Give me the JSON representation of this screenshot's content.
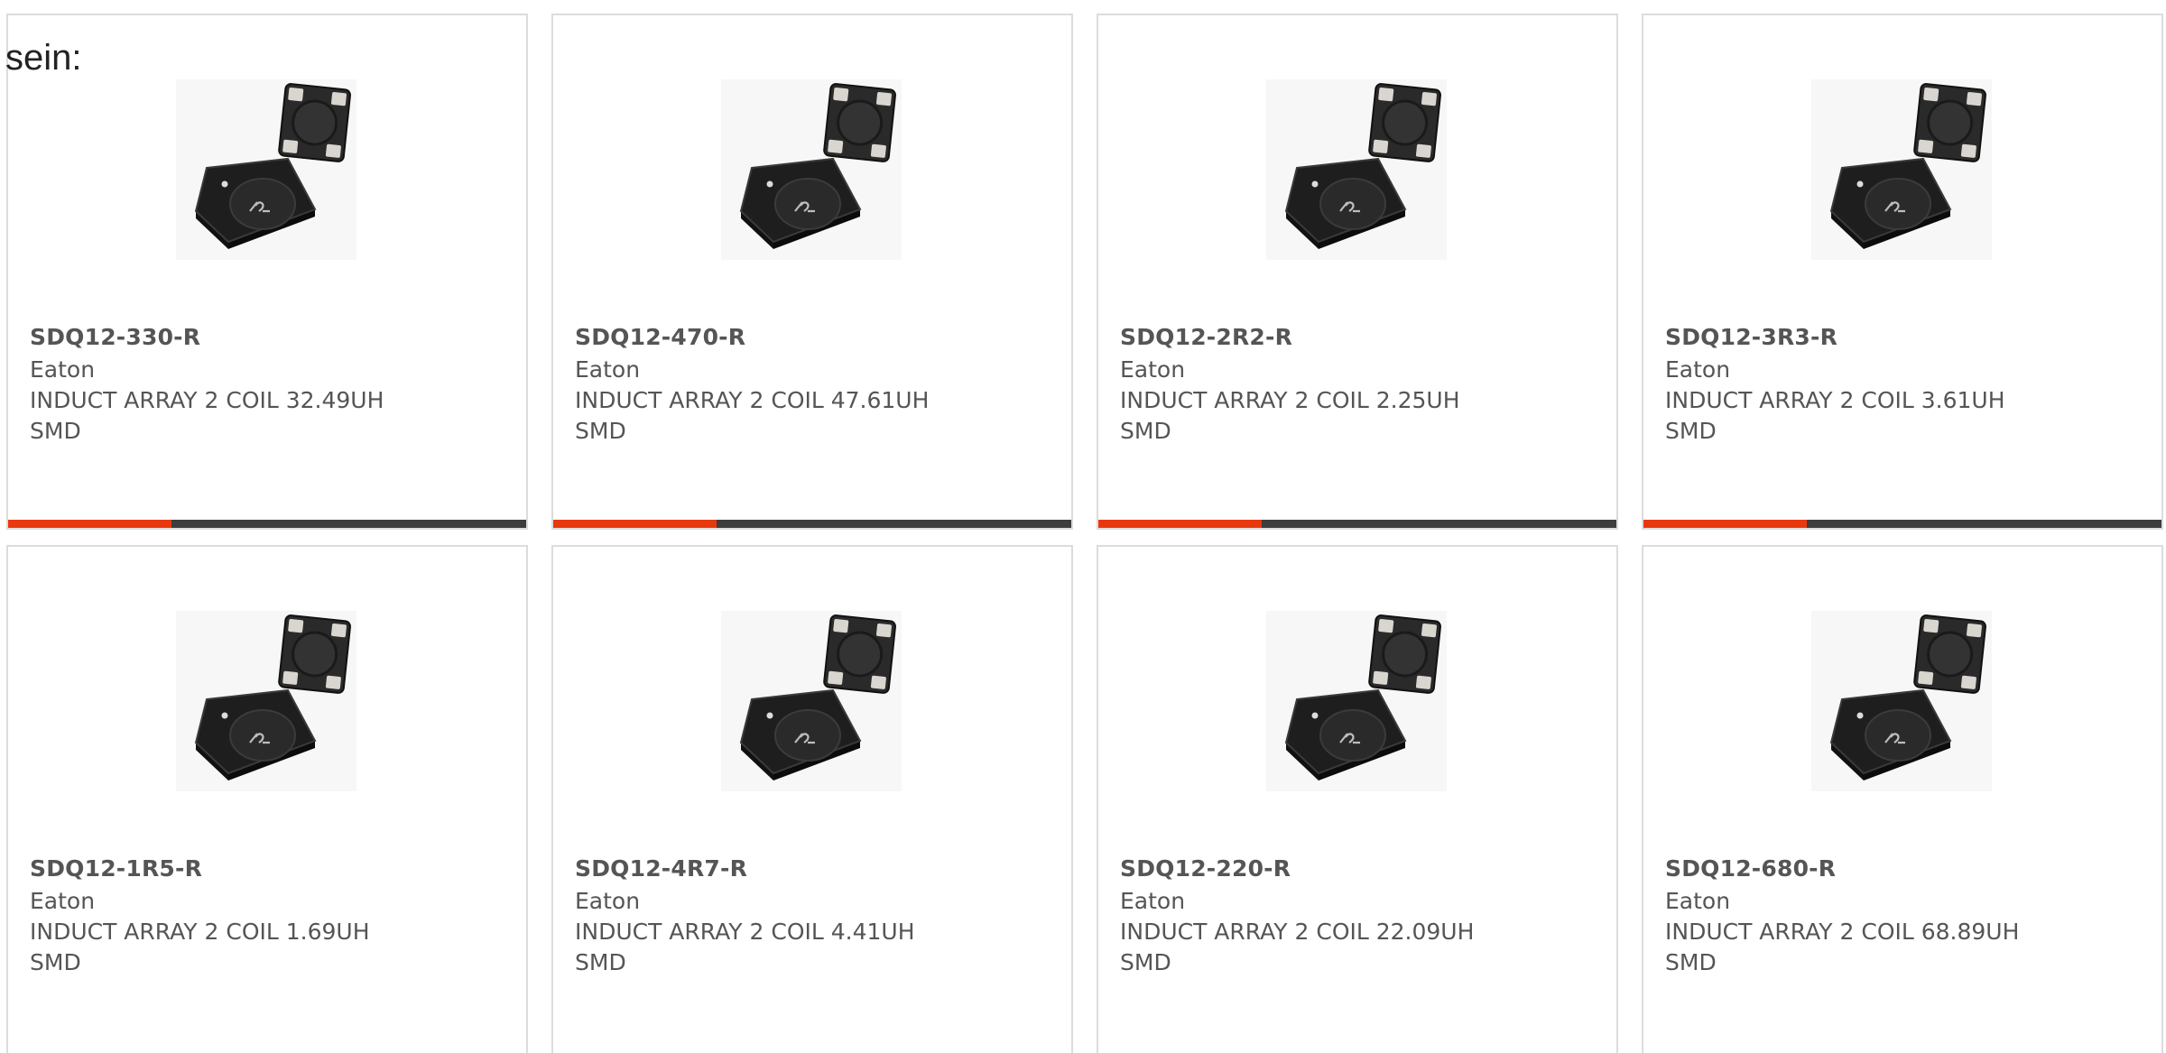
{
  "intro_text": "sein:",
  "colors": {
    "accent": "#e8390e",
    "bar_track": "#3d3d3d",
    "text": "#555555",
    "card_border": "#dcdcdc"
  },
  "products": [
    {
      "part": "SDQ12-330-R",
      "manufacturer": "Eaton",
      "description": "INDUCT ARRAY 2 COIL 32.49UH",
      "package": "SMD",
      "bar_fill_fraction": 0.315
    },
    {
      "part": "SDQ12-470-R",
      "manufacturer": "Eaton",
      "description": "INDUCT ARRAY 2 COIL 47.61UH",
      "package": "SMD",
      "bar_fill_fraction": 0.315
    },
    {
      "part": "SDQ12-2R2-R",
      "manufacturer": "Eaton",
      "description": "INDUCT ARRAY 2 COIL 2.25UH",
      "package": "SMD",
      "bar_fill_fraction": 0.315
    },
    {
      "part": "SDQ12-3R3-R",
      "manufacturer": "Eaton",
      "description": "INDUCT ARRAY 2 COIL 3.61UH",
      "package": "SMD",
      "bar_fill_fraction": 0.315
    },
    {
      "part": "SDQ12-1R5-R",
      "manufacturer": "Eaton",
      "description": "INDUCT ARRAY 2 COIL 1.69UH",
      "package": "SMD"
    },
    {
      "part": "SDQ12-4R7-R",
      "manufacturer": "Eaton",
      "description": "INDUCT ARRAY 2 COIL 4.41UH",
      "package": "SMD"
    },
    {
      "part": "SDQ12-220-R",
      "manufacturer": "Eaton",
      "description": "INDUCT ARRAY 2 COIL 22.09UH",
      "package": "SMD"
    },
    {
      "part": "SDQ12-680-R",
      "manufacturer": "Eaton",
      "description": "INDUCT ARRAY 2 COIL 68.89UH",
      "package": "SMD"
    }
  ]
}
